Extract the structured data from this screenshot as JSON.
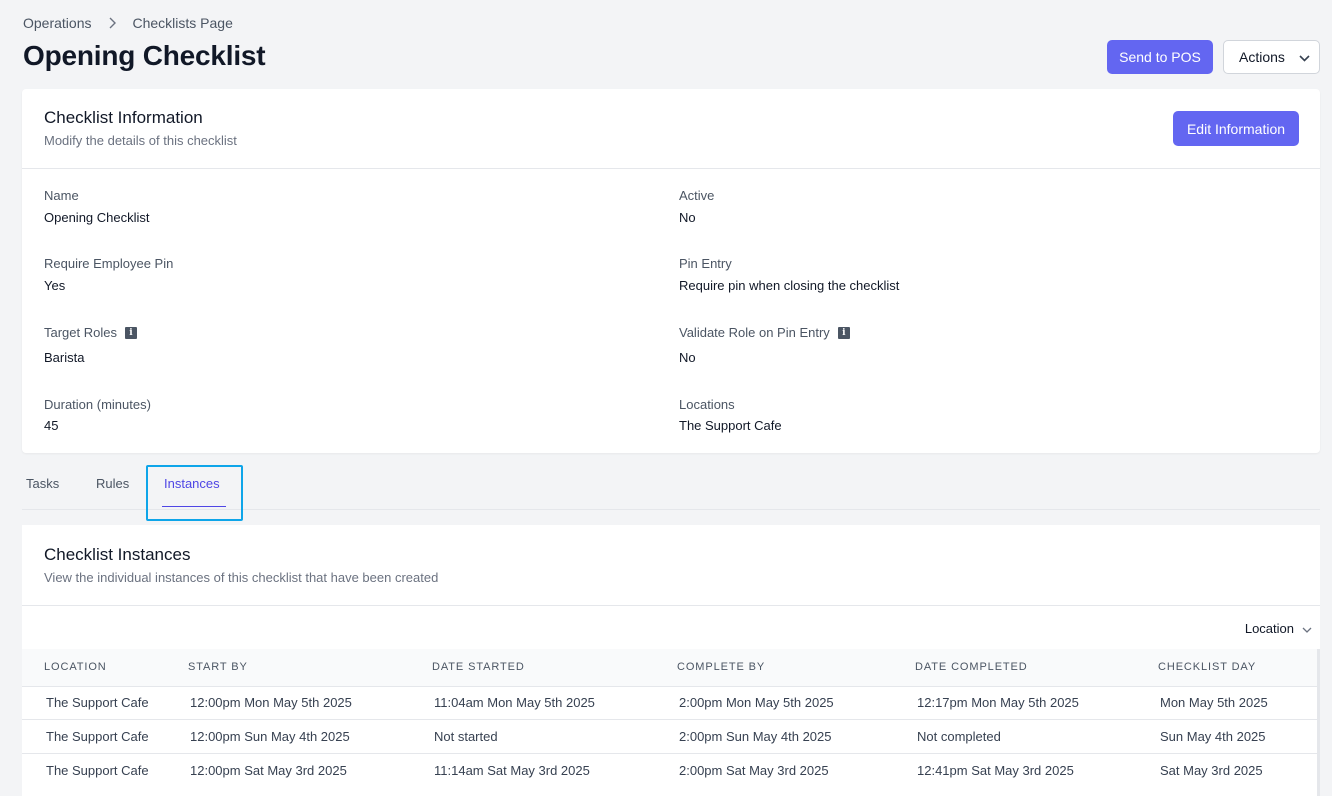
{
  "breadcrumb": {
    "items": [
      "Operations",
      "Checklists Page"
    ]
  },
  "page": {
    "title": "Opening Checklist"
  },
  "header_actions": {
    "send_label": "Send to POS",
    "actions_label": "Actions"
  },
  "info": {
    "title": "Checklist Information",
    "subtitle": "Modify the details of this checklist",
    "edit_label": "Edit Information",
    "fields": {
      "name": {
        "label": "Name",
        "value": "Opening Checklist"
      },
      "active": {
        "label": "Active",
        "value": "No"
      },
      "require_pin": {
        "label": "Require Employee Pin",
        "value": "Yes"
      },
      "pin_entry": {
        "label": "Pin Entry",
        "value": "Require pin when closing the checklist"
      },
      "target_roles": {
        "label": "Target Roles",
        "value": "Barista"
      },
      "validate_role": {
        "label": "Validate Role on Pin Entry",
        "value": "No"
      },
      "duration": {
        "label": "Duration (minutes)",
        "value": "45"
      },
      "locations": {
        "label": "Locations",
        "value": "The Support Cafe"
      }
    }
  },
  "tabs": [
    {
      "label": "Tasks",
      "active": false
    },
    {
      "label": "Rules",
      "active": false
    },
    {
      "label": "Instances",
      "active": true
    }
  ],
  "instances": {
    "title": "Checklist Instances",
    "subtitle": "View the individual instances of this checklist that have been created",
    "filter_label": "Location",
    "columns": [
      "Location",
      "Start By",
      "Date Started",
      "Complete By",
      "Date Completed",
      "Checklist Day"
    ],
    "rows": [
      [
        "The Support Cafe",
        "12:00pm Mon May 5th 2025",
        "11:04am Mon May 5th 2025",
        "2:00pm Mon May 5th 2025",
        "12:17pm Mon May 5th 2025",
        "Mon May 5th 2025"
      ],
      [
        "The Support Cafe",
        "12:00pm Sun May 4th 2025",
        "Not started",
        "2:00pm Sun May 4th 2025",
        "Not completed",
        "Sun May 4th 2025"
      ],
      [
        "The Support Cafe",
        "12:00pm Sat May 3rd 2025",
        "11:14am Sat May 3rd 2025",
        "2:00pm Sat May 3rd 2025",
        "12:41pm Sat May 3rd 2025",
        "Sat May 3rd 2025"
      ]
    ]
  },
  "icons": {
    "breadcrumb_separator": "chevron-right-icon",
    "actions_dropdown": "chevron-down-icon",
    "field_info": "info-icon",
    "filter_dropdown": "chevron-down-icon"
  }
}
